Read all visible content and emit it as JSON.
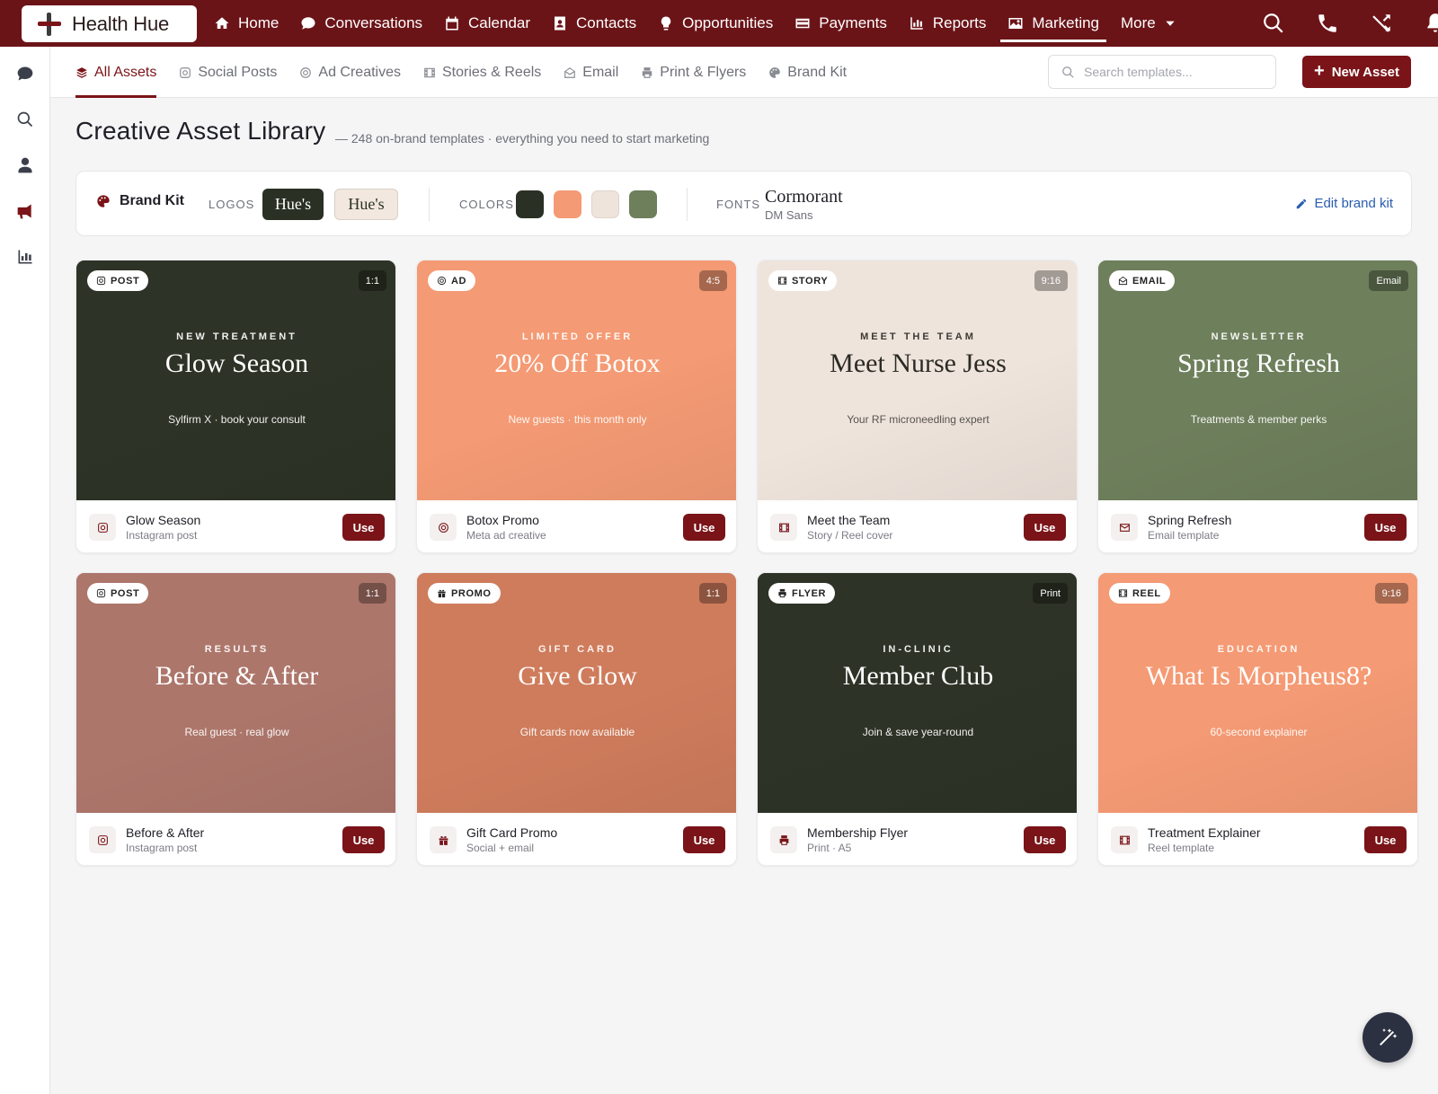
{
  "app": {
    "name": "Health Hue"
  },
  "nav": {
    "items": [
      {
        "label": "Home",
        "icon": "home-icon"
      },
      {
        "label": "Conversations",
        "icon": "chat-icon"
      },
      {
        "label": "Calendar",
        "icon": "calendar-icon"
      },
      {
        "label": "Contacts",
        "icon": "contact-card-icon"
      },
      {
        "label": "Opportunities",
        "icon": "lightbulb-icon"
      },
      {
        "label": "Payments",
        "icon": "credit-card-icon"
      },
      {
        "label": "Reports",
        "icon": "bar-chart-icon"
      },
      {
        "label": "Marketing",
        "icon": "image-icon",
        "active": true
      },
      {
        "label": "More",
        "icon": "caret-down-icon"
      }
    ],
    "right_icons": [
      "search-icon",
      "phone-icon",
      "shuffle-icon",
      "bell-icon"
    ]
  },
  "rail": {
    "icons": [
      "chat-icon",
      "search-icon",
      "user-icon",
      "megaphone-icon",
      "bar-chart-icon"
    ],
    "active": "megaphone-icon"
  },
  "tabs": [
    {
      "label": "All Assets",
      "icon": "layers-icon",
      "active": true
    },
    {
      "label": "Social Posts",
      "icon": "instagram-icon"
    },
    {
      "label": "Ad Creatives",
      "icon": "target-icon"
    },
    {
      "label": "Stories & Reels",
      "icon": "film-icon"
    },
    {
      "label": "Email",
      "icon": "envelope-open-icon"
    },
    {
      "label": "Print & Flyers",
      "icon": "printer-icon"
    },
    {
      "label": "Brand Kit",
      "icon": "palette-icon"
    }
  ],
  "search": {
    "placeholder": "Search templates...",
    "value": ""
  },
  "new_asset_label": "New Asset",
  "header": {
    "title": "Creative Asset Library",
    "subtitle": "— 248 on-brand templates · everything you need to start marketing"
  },
  "brand_kit": {
    "title": "Brand Kit",
    "logos_label": "LOGOS",
    "logo_dark": "Hue's",
    "logo_light": "Hue's",
    "colors_label": "COLORS",
    "colors": [
      "#2a3124",
      "#f49a74",
      "#efe4dc",
      "#6e7f5c"
    ],
    "fonts_label": "FONTS",
    "font_primary": "Cormorant",
    "font_secondary": "DM Sans",
    "edit_label": "Edit brand kit"
  },
  "cards": [
    {
      "chip": "POST",
      "chip_icon": "instagram-icon",
      "ratio": "1:1",
      "eyebrow": "NEW TREATMENT",
      "headline": "Glow Season",
      "tagline": "Sylfirm X · book your consult",
      "title": "Glow Season",
      "sub": "Instagram post",
      "foot_icon": "instagram-icon",
      "bg": "#2d3326",
      "text": "#ffffff"
    },
    {
      "chip": "AD",
      "chip_icon": "target-icon",
      "ratio": "4:5",
      "eyebrow": "LIMITED OFFER",
      "headline": "20% Off Botox",
      "tagline": "New guests · this month only",
      "title": "Botox Promo",
      "sub": "Meta ad creative",
      "foot_icon": "target-icon",
      "bg": "#f49a74",
      "text": "#ffffff"
    },
    {
      "chip": "STORY",
      "chip_icon": "film-icon",
      "ratio": "9:16",
      "eyebrow": "MEET THE TEAM",
      "headline": "Meet Nurse Jess",
      "tagline": "Your RF microneedling expert",
      "title": "Meet the Team",
      "sub": "Story / Reel cover",
      "foot_icon": "film-icon",
      "bg": "#efe4dc",
      "text": "#2a2a24"
    },
    {
      "chip": "EMAIL",
      "chip_icon": "envelope-open-icon",
      "ratio": "Email",
      "eyebrow": "NEWSLETTER",
      "headline": "Spring Refresh",
      "tagline": "Treatments & member perks",
      "title": "Spring Refresh",
      "sub": "Email template",
      "foot_icon": "envelope-icon",
      "bg": "#6e7f5c",
      "text": "#ffffff"
    },
    {
      "chip": "POST",
      "chip_icon": "instagram-icon",
      "ratio": "1:1",
      "eyebrow": "RESULTS",
      "headline": "Before & After",
      "tagline": "Real guest · real glow",
      "title": "Before & After",
      "sub": "Instagram post",
      "foot_icon": "instagram-icon",
      "bg": "#ad766b",
      "text": "#ffffff"
    },
    {
      "chip": "PROMO",
      "chip_icon": "gift-icon",
      "ratio": "1:1",
      "eyebrow": "GIFT CARD",
      "headline": "Give Glow",
      "tagline": "Gift cards now available",
      "title": "Gift Card Promo",
      "sub": "Social + email",
      "foot_icon": "gift-icon",
      "bg": "#cf7c5c",
      "text": "#ffffff"
    },
    {
      "chip": "FLYER",
      "chip_icon": "printer-icon",
      "ratio": "Print",
      "eyebrow": "IN-CLINIC",
      "headline": "Member Club",
      "tagline": "Join & save year-round",
      "title": "Membership Flyer",
      "sub": "Print · A5",
      "foot_icon": "printer-icon",
      "bg": "#2d3326",
      "text": "#ffffff"
    },
    {
      "chip": "REEL",
      "chip_icon": "film-icon",
      "ratio": "9:16",
      "eyebrow": "EDUCATION",
      "headline": "What Is Morpheus8?",
      "tagline": "60-second explainer",
      "title": "Treatment Explainer",
      "sub": "Reel template",
      "foot_icon": "film-icon",
      "bg": "#f49a74",
      "text": "#ffffff"
    }
  ],
  "use_label": "Use",
  "colors": {
    "primary": "#7a1418",
    "topbar": "#6b1418",
    "link": "#2a5db0"
  }
}
